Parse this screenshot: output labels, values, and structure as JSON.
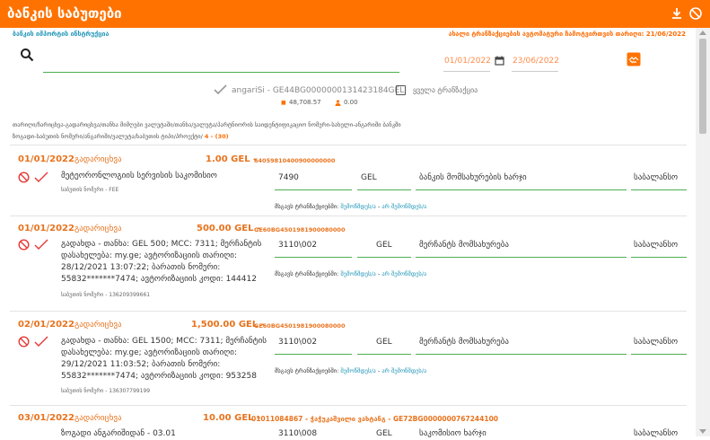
{
  "header": {
    "title": "ბანკის საბუთები",
    "left_link": "ბანკის იმპორტის ინსტრუქცია",
    "right_note": "ახალი ტრანზაქციების ავტომატური ჩამოტვირთვის თარიღი: 21/06/2022",
    "download_icon": "download-icon",
    "close_icon": "block-icon"
  },
  "filters": {
    "search_value": "",
    "date_from": "01/01/2022",
    "date_to": "23/06/2022",
    "account": "angariSi - GE44BG0000000131423184GEL",
    "all_transactions_label": "ყველა ტრანზაქცია",
    "balance_positive": "48,708.57",
    "balance_negative": "0.00"
  },
  "info": {
    "line1": "თარიღი/ჩარიცხვა-გადარიცხვა/თანხა მიმღები ვალუტაში/თანხა/ვალუტა/პარტნიორის საიდენტიფიკაციო ნომერი-სახელი-ანგარიში ბანკში",
    "line2": "ზოგადი-საბუთის ნომერი/ანგარიში/ვალუტა/საბუთის ტიპი/პროექტი/",
    "count": "4 - (30)"
  },
  "rows": [
    {
      "date": "01/01/2022",
      "type": "გადარიცხვა",
      "amount": "1.00 GEL -",
      "extra": "64059810400900000000",
      "desc": "მეტეორონლოგიის სერვისის საკომისიო",
      "doc": "საბუთის ნომერი - FEE",
      "account": "7490",
      "currency": "GEL",
      "category": "ბანკის მომსახურების ხარჯი",
      "subject": "საბალანსო",
      "status_label": "მსგავს ტრანზაქციებში:",
      "status_value": "შემოწმდეს/ა",
      "status_value2": "არ შემოწმდეს/ა"
    },
    {
      "date": "01/01/2022",
      "type": "გადარიცხვა",
      "amount": "500.00 GEL -",
      "extra": "GE60BG4501981900080000",
      "desc": "გადახდა - თანხა: GEL 500; MCC: 7311; მერჩანტის დასახელება: my.ge; ავტორიზაციის თარიღი: 28/12/2021 13:07:22; ბარათის ნომერი: 55832*******7474; ავტორიზაციის კოდი: 144412",
      "doc": "საბუთის ნომერი - 136209399661",
      "account": "3110\\002",
      "currency": "GEL",
      "category": "მერჩანტს მომსახურება",
      "subject": "საბალანსო",
      "status_label": "მსგავს ტრანზაქციებში:",
      "status_value": "შემოწმდეს/ა",
      "status_value2": "არ შემოწმდეს/ა"
    },
    {
      "date": "02/01/2022",
      "type": "გადარიცხვა",
      "amount": "1,500.00 GEL -",
      "extra": "GE60BG4501981900080000",
      "desc": "გადახდა - თანხა: GEL 1500; MCC: 7311; მერჩანტის დასახელება: my.ge; ავტორიზაციის თარიღი: 29/12/2021 11:03:52; ბარათის ნომერი: 55832*******7474; ავტორიზაციის კოდი: 953258",
      "doc": "საბუთის ნომერი - 136307799199",
      "account": "3110\\002",
      "currency": "GEL",
      "category": "მერჩანტს მომსახურება",
      "subject": "საბალანსო",
      "status_label": "მსგავს ტრანზაქციებში:",
      "status_value": "შემოწმდეს/ა",
      "status_value2": "არ შემოწმდეს/ა"
    },
    {
      "date": "03/01/2022",
      "type": "გადარიცხვა",
      "amount": "10.00 GEL -",
      "extra": "01011084867 - ჭაჭუკაშვილი ვახტანგ - GE72BG0000000767244100",
      "desc": "ზოგადი ანგარიშიდან - 03.01",
      "account": "3110\\008",
      "currency": "GEL",
      "category": "საკომისიო ხარჯი",
      "subject": "საბალანსო"
    }
  ]
}
